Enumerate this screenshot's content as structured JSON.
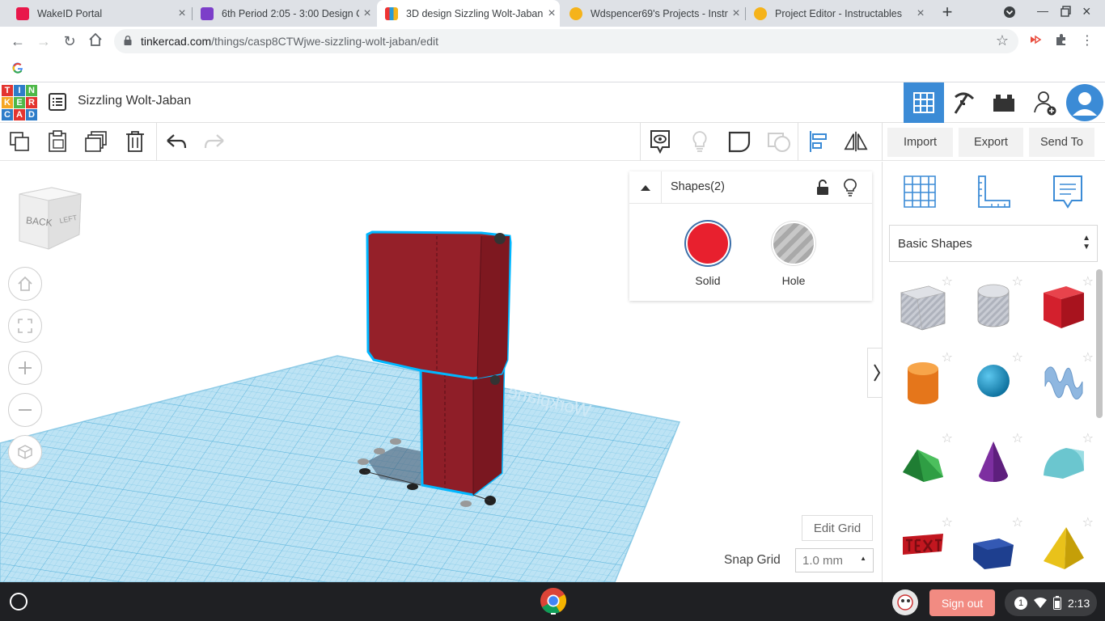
{
  "browser": {
    "tabs": [
      {
        "title": "WakeID Portal",
        "favicon_color": "#e8174a"
      },
      {
        "title": "6th Period 2:05 - 3:00 Design C",
        "favicon_color": "#7c3ec9"
      },
      {
        "title": "3D design Sizzling Wolt-Jaban",
        "favicon_color": "#2a9ad6"
      },
      {
        "title": "Wdspencer69's Projects - Instru",
        "favicon_color": "#f5b31a"
      },
      {
        "title": "Project Editor - Instructables",
        "favicon_color": "#f5b31a"
      }
    ],
    "url_domain": "tinkercad.com",
    "url_path": "/things/casp8CTWjwe-sizzling-wolt-jaban/edit"
  },
  "app": {
    "logo_letters": [
      "T",
      "I",
      "N",
      "K",
      "E",
      "R",
      "C",
      "A",
      "D"
    ],
    "design_title": "Sizzling Wolt-Jaban"
  },
  "toolbar": {
    "import_label": "Import",
    "export_label": "Export",
    "send_to_label": "Send To"
  },
  "workplane": {
    "viewcube_back": "BACK",
    "viewcube_left": "LEFT",
    "watermark": "Workplane",
    "edit_grid_label": "Edit Grid",
    "snap_grid_label": "Snap Grid",
    "snap_grid_value": "1.0 mm"
  },
  "inspector": {
    "title": "Shapes(2)",
    "solid_label": "Solid",
    "hole_label": "Hole",
    "solid_color": "#e8202e"
  },
  "shapes_panel": {
    "category": "Basic Shapes"
  },
  "shelf": {
    "sign_out_label": "Sign out",
    "notification_count": "1",
    "time": "2:13"
  }
}
